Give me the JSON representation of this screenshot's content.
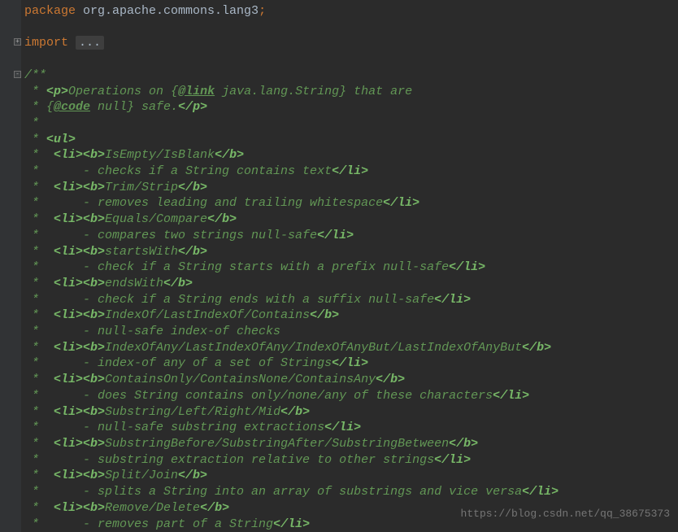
{
  "package_keyword": "package",
  "package_name": " org.apache.commons.lang3",
  "semicolon": ";",
  "import_keyword": "import",
  "import_dots": "...",
  "lines": [
    {
      "star": "/**"
    },
    {
      "star": " * ",
      "t1": "<p>",
      "txt1": "Operations on {",
      "doctag": "@link",
      "txt2": " java.lang.String",
      "txt3": "} that are"
    },
    {
      "star": " * {",
      "doctag": "@code",
      "txt1": " null} safe.",
      "t1": "</p>"
    },
    {
      "star": " *"
    },
    {
      "star": " * ",
      "t1": "<ul>"
    },
    {
      "star": " *  ",
      "t1": "<li><b>",
      "txt1": "IsEmpty/IsBlank",
      "t2": "</b>"
    },
    {
      "star": " *      ",
      "txt1": "- checks if a String contains text",
      "t1": "</li>"
    },
    {
      "star": " *  ",
      "t1": "<li><b>",
      "txt1": "Trim/Strip",
      "t2": "</b>"
    },
    {
      "star": " *      ",
      "txt1": "- removes leading and trailing whitespace",
      "t1": "</li>"
    },
    {
      "star": " *  ",
      "t1": "<li><b>",
      "txt1": "Equals/Compare",
      "t2": "</b>"
    },
    {
      "star": " *      ",
      "txt1": "- compares two strings null-safe",
      "t1": "</li>"
    },
    {
      "star": " *  ",
      "t1": "<li><b>",
      "txt1": "startsWith",
      "t2": "</b>"
    },
    {
      "star": " *      ",
      "txt1": "- check if a String starts with a prefix null-safe",
      "t1": "</li>"
    },
    {
      "star": " *  ",
      "t1": "<li><b>",
      "txt1": "endsWith",
      "t2": "</b>"
    },
    {
      "star": " *      ",
      "txt1": "- check if a String ends with a suffix null-safe",
      "t1": "</li>"
    },
    {
      "star": " *  ",
      "t1": "<li><b>",
      "txt1": "IndexOf/LastIndexOf/Contains",
      "t2": "</b>"
    },
    {
      "star": " *      ",
      "txt1": "- null-safe index-of checks"
    },
    {
      "star": " *  ",
      "t1": "<li><b>",
      "txt1": "IndexOfAny/LastIndexOfAny/IndexOfAnyBut/LastIndexOfAnyBut",
      "t2": "</b>"
    },
    {
      "star": " *      ",
      "txt1": "- index-of any of a set of Strings",
      "t1": "</li>"
    },
    {
      "star": " *  ",
      "t1": "<li><b>",
      "txt1": "ContainsOnly/ContainsNone/ContainsAny",
      "t2": "</b>"
    },
    {
      "star": " *      ",
      "txt1": "- does String contains only/none/any of these characters",
      "t1": "</li>"
    },
    {
      "star": " *  ",
      "t1": "<li><b>",
      "txt1": "Substring/Left/Right/Mid",
      "t2": "</b>"
    },
    {
      "star": " *      ",
      "txt1": "- null-safe substring extractions",
      "t1": "</li>"
    },
    {
      "star": " *  ",
      "t1": "<li><b>",
      "txt1": "SubstringBefore/SubstringAfter/SubstringBetween",
      "t2": "</b>"
    },
    {
      "star": " *      ",
      "txt1": "- substring extraction relative to other strings",
      "t1": "</li>"
    },
    {
      "star": " *  ",
      "t1": "<li><b>",
      "txt1": "Split/Join",
      "t2": "</b>"
    },
    {
      "star": " *      ",
      "txt1": "- splits a String into an array of substrings and vice versa",
      "t1": "</li>"
    },
    {
      "star": " *  ",
      "t1": "<li><b>",
      "txt1": "Remove/Delete",
      "t2": "</b>"
    },
    {
      "star": " *      ",
      "txt1": "- removes part of a String",
      "t1": "</li>"
    }
  ],
  "watermark": "https://blog.csdn.net/qq_38675373"
}
